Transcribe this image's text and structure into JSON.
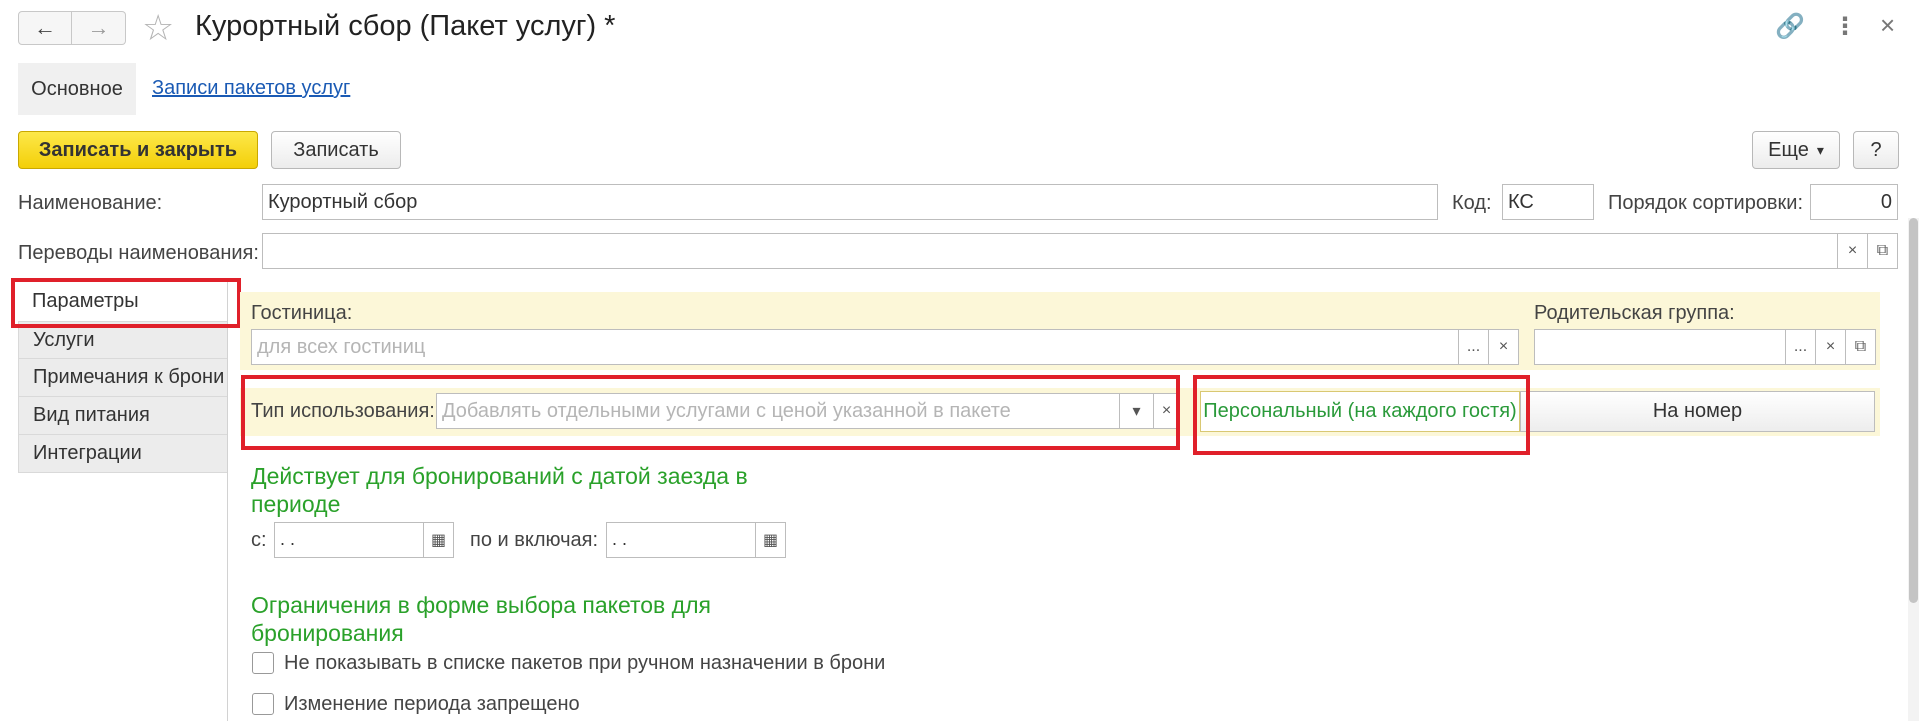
{
  "window": {
    "title": "Курортный сбор (Пакет услуг) *",
    "back_icon": "←",
    "forward_icon": "→",
    "star_icon": "☆",
    "link_icon": "🔗",
    "more_icon": "⋮",
    "close_icon": "×"
  },
  "tabs": {
    "main_label": "Основное",
    "records_label": "Записи пакетов услуг"
  },
  "toolbar": {
    "save_close_label": "Записать и закрыть",
    "save_label": "Записать",
    "more_label": "Еще",
    "more_arrow": "▾",
    "help_label": "?"
  },
  "form": {
    "name_label": "Наименование:",
    "name_value": "Курортный сбор",
    "code_label": "Код:",
    "code_value": "КС",
    "sort_label": "Порядок сортировки:",
    "sort_value": "0",
    "translations_label": "Переводы наименования:",
    "translations_value": ""
  },
  "side_tabs": [
    {
      "label": "Параметры"
    },
    {
      "label": "Услуги"
    },
    {
      "label": "Примечания к брони"
    },
    {
      "label": "Вид питания"
    },
    {
      "label": "Интеграции"
    }
  ],
  "params": {
    "hotel_label": "Гостиница:",
    "hotel_placeholder": "для всех гостиниц",
    "parent_label": "Родительская группа:",
    "parent_value": "",
    "usage_label": "Тип использования:",
    "usage_placeholder": "Добавлять отдельными услугами с ценой указанной в пакете",
    "toggle_personal": "Персональный (на каждого гостя)",
    "toggle_room": "На номер",
    "ellipsis": "...",
    "clear": "×",
    "open": "⧉",
    "dropdown": "▾",
    "calendar": "▦"
  },
  "period": {
    "heading": "Действует для бронирований с датой заезда в периоде",
    "from_label": "с:",
    "from_value": "  .   .",
    "to_label": "по и включая:",
    "to_value": "  .   ."
  },
  "restrictions": {
    "heading": "Ограничения в форме выбора пакетов для бронирования",
    "check1_label": "Не показывать в списке пакетов при ручном назначении в брони",
    "check2_label": "Изменение периода запрещено"
  },
  "colors": {
    "accent_yellow": "#f3cf08",
    "highlight_red": "#e0202a",
    "section_green": "#2aa12a",
    "link_blue": "#1a5ab4"
  }
}
